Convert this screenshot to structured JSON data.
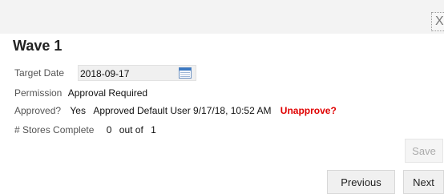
{
  "dialog": {
    "close_label": "X",
    "title": "Wave 1"
  },
  "fields": {
    "target_date": {
      "label": "Target Date",
      "value": "2018-09-17"
    },
    "permission": {
      "label": "Permission",
      "value": "Approval Required"
    },
    "approved": {
      "label": "Approved?",
      "value": "Yes",
      "detail": "Approved Default User 9/17/18, 10:52 AM",
      "action": "Unapprove?"
    },
    "stores": {
      "label": "# Stores Complete",
      "completed": "0",
      "out_of_label": "out of",
      "total": "1"
    }
  },
  "buttons": {
    "save": "Save",
    "previous": "Previous",
    "next": "Next"
  },
  "icons": {
    "calendar": "calendar-icon",
    "close": "close-icon"
  },
  "colors": {
    "accent_red": "#e00000",
    "calendar_blue": "#3a78c2"
  }
}
